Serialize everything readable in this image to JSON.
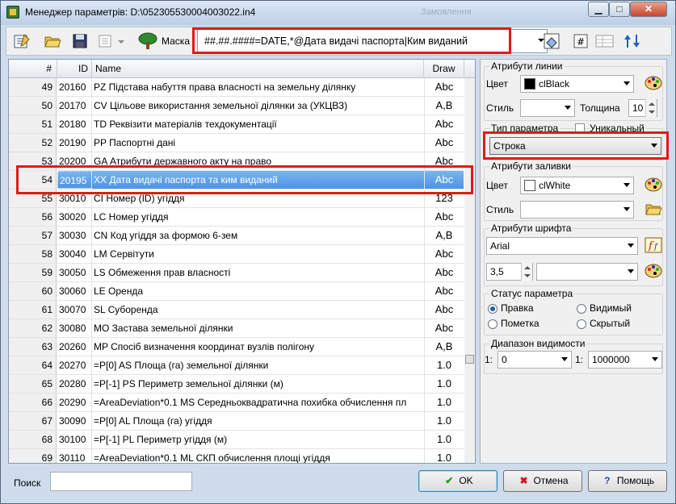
{
  "window": {
    "title": "Менеджер параметрів: D:\\052305530004003022.in4",
    "faded_title": "Замовлення"
  },
  "toolbar": {
    "mask_label": "Маска",
    "mask_value": "##.##.####=DATE,*@Дата видачі паспорта|Ким виданий"
  },
  "table": {
    "headers": {
      "num": "#",
      "id": "ID",
      "name": "Name",
      "draw": "Draw"
    },
    "selected_row": 5,
    "rows": [
      {
        "num": "49",
        "id": "20160",
        "name": "PZ Підстава набуття права власності на земельну ділянку",
        "draw": "Abc"
      },
      {
        "num": "50",
        "id": "20170",
        "name": "CV Цільове використання земельної ділянки за (УКЦВЗ)",
        "draw": "A,B"
      },
      {
        "num": "51",
        "id": "20180",
        "name": "TD Реквізити матеріалів техдокументації",
        "draw": "Abc"
      },
      {
        "num": "52",
        "id": "20190",
        "name": "PP Паспортні дані",
        "draw": "Abc"
      },
      {
        "num": "53",
        "id": "20200",
        "name": "GA Атрибути державного акту на право",
        "draw": "Abc"
      },
      {
        "num": "54",
        "id": "20195",
        "name": "XX Дата видачі паспорта та ким виданий",
        "draw": "Abc"
      },
      {
        "num": "55",
        "id": "30010",
        "name": "CI Номер (ID) угіддя",
        "draw": "123"
      },
      {
        "num": "56",
        "id": "30020",
        "name": "LC Номер угіддя",
        "draw": "Abc"
      },
      {
        "num": "57",
        "id": "30030",
        "name": "CN Код угіддя за формою 6-зем",
        "draw": "A,B"
      },
      {
        "num": "58",
        "id": "30040",
        "name": "LM Сервітути",
        "draw": "Abc"
      },
      {
        "num": "59",
        "id": "30050",
        "name": "LS Обмеження прав власності",
        "draw": "Abc"
      },
      {
        "num": "60",
        "id": "30060",
        "name": "LE Оренда",
        "draw": "Abc"
      },
      {
        "num": "61",
        "id": "30070",
        "name": "SL Суборенда",
        "draw": "Abc"
      },
      {
        "num": "62",
        "id": "30080",
        "name": "MO Застава земельної ділянки",
        "draw": "Abc"
      },
      {
        "num": "63",
        "id": "20260",
        "name": "MP Спосіб визначення координат вузлів полігону",
        "draw": "A,B"
      },
      {
        "num": "64",
        "id": "20270",
        "name": "=P[0] AS Площа (га) земельної ділянки",
        "draw": "1.0"
      },
      {
        "num": "65",
        "id": "20280",
        "name": "=P[-1] PS Периметр земельної ділянки (м)",
        "draw": "1.0"
      },
      {
        "num": "66",
        "id": "20290",
        "name": "=AreaDeviation*0.1 MS Середньоквадратична похибка обчислення пл",
        "draw": "1.0"
      },
      {
        "num": "67",
        "id": "30090",
        "name": "=P[0] AL Площа (га) угіддя",
        "draw": "1.0"
      },
      {
        "num": "68",
        "id": "30100",
        "name": "=P[-1] PL Периметр угіддя (м)",
        "draw": "1.0"
      },
      {
        "num": "69",
        "id": "30110",
        "name": "=AreaDeviation*0.1 ML СКП обчислення площі угіддя",
        "draw": "1.0"
      }
    ]
  },
  "panel": {
    "line_attrs": {
      "title": "Атрибути линии",
      "color_label": "Цвет",
      "color_value": "clBlack",
      "color_hex": "#000000",
      "style_label": "Стиль",
      "width_label": "Толщина",
      "width_value": "10"
    },
    "param_type": {
      "title": "Тип параметра",
      "unique_label": "Уникальный",
      "value": "Строка"
    },
    "fill_attrs": {
      "title": "Атрибути заливки",
      "color_label": "Цвет",
      "color_value": "clWhite",
      "color_hex": "#ffffff",
      "style_label": "Стиль"
    },
    "font_attrs": {
      "title": "Атрибути шрифта",
      "font_value": "Arial",
      "size_value": "3,5"
    },
    "status": {
      "title": "Статус параметра",
      "options": [
        "Правка",
        "Видимый",
        "Пометка",
        "Скрытый"
      ],
      "selected": "Правка"
    },
    "visibility": {
      "title": "Диапазон видимости",
      "from_prefix": "1:",
      "from_value": "0",
      "to_prefix": "1:",
      "to_value": "1000000"
    }
  },
  "bottom": {
    "search_label": "Поиск",
    "ok_label": "OK",
    "cancel_label": "Отмена",
    "help_label": "Помощь"
  }
}
